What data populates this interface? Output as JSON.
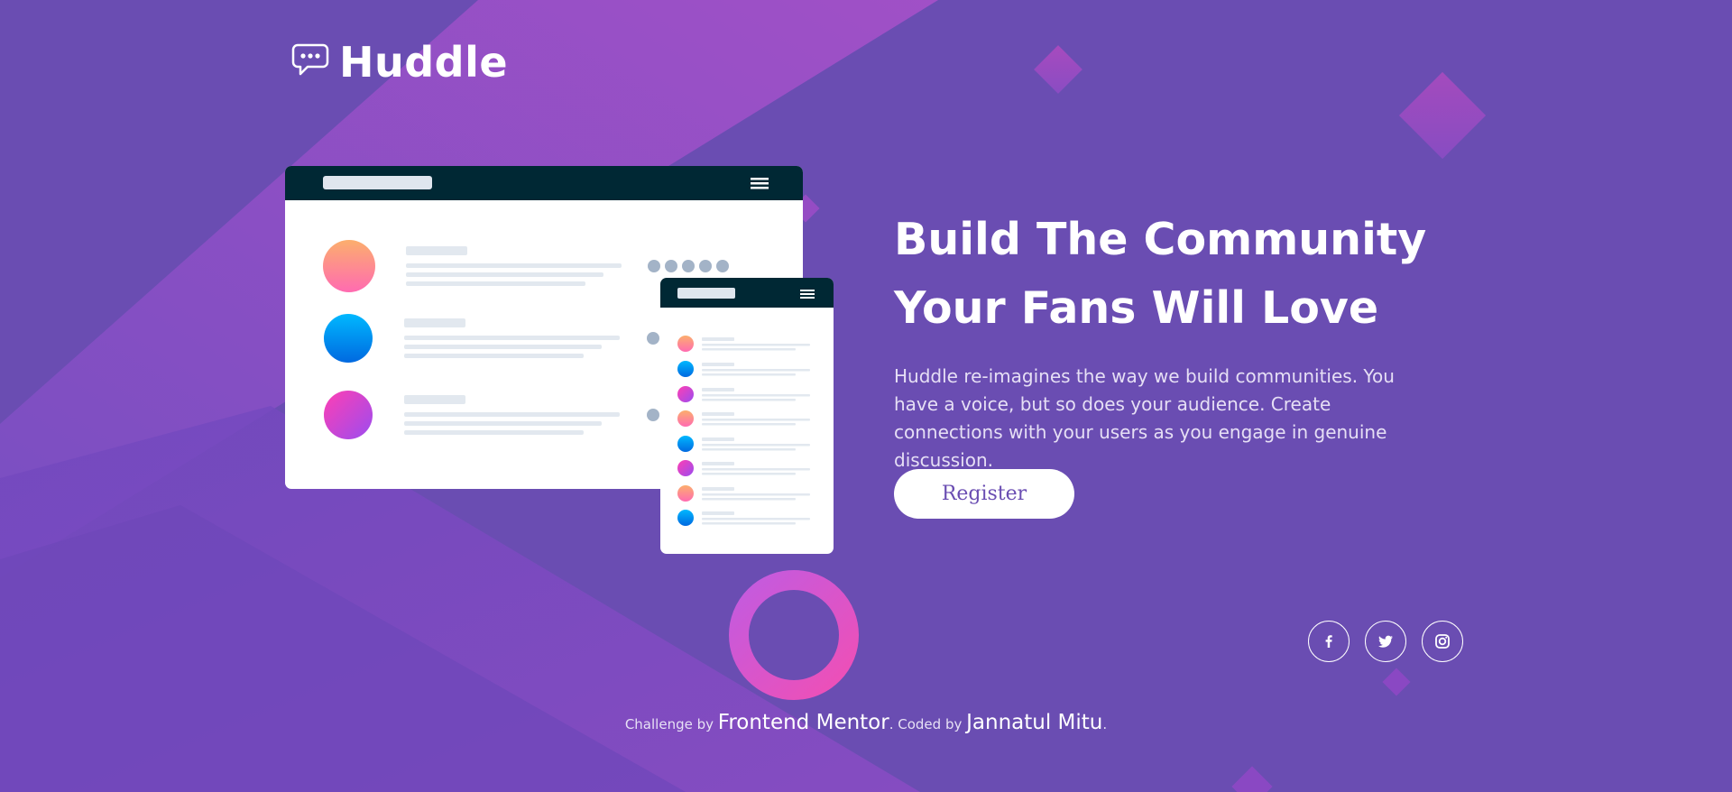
{
  "brand": {
    "name": "Huddle",
    "logo_icon": "chat-bubble-icon"
  },
  "hero": {
    "title_line1": "Build The Community",
    "title_line2": "Your Fans Will Love",
    "description": "Huddle re-imagines the way we build communities. You have a voice, but so does your audience. Create connections with your users as you engage in genuine discussion.",
    "register_label": "Register"
  },
  "social": [
    {
      "icon": "facebook-icon"
    },
    {
      "icon": "twitter-icon"
    },
    {
      "icon": "instagram-icon"
    }
  ],
  "attribution": {
    "prefix": "Challenge by",
    "challenge_link": "Frontend Mentor",
    "middle": ". Coded by",
    "author_link": "Jannatul Mitu",
    "suffix": "."
  },
  "colors": {
    "background": "#6a4db2",
    "accent_pink": "#d54ec9",
    "window_bar": "#002834"
  }
}
